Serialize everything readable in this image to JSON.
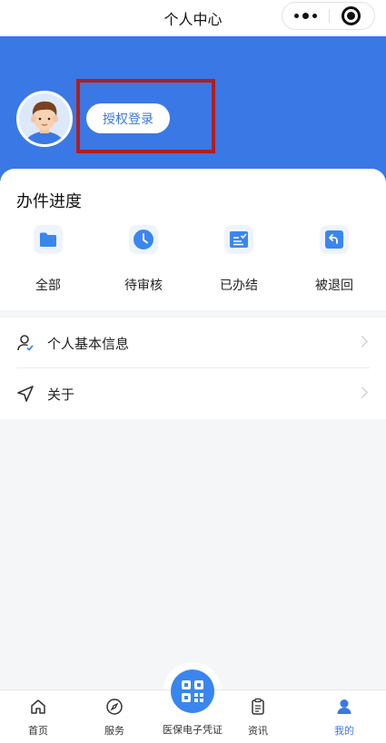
{
  "nav": {
    "title": "个人中心",
    "more_icon": "more-dots-icon",
    "close_icon": "close-circle-icon"
  },
  "header": {
    "avatar_icon": "user-avatar",
    "login_label": "授权登录",
    "accent": "#3a78e6",
    "highlight_color": "#b11e1e"
  },
  "progress": {
    "title": "办件进度",
    "items": [
      {
        "label": "全部",
        "icon": "folder-icon"
      },
      {
        "label": "待审核",
        "icon": "clock-icon"
      },
      {
        "label": "已办结",
        "icon": "check-list-icon"
      },
      {
        "label": "被退回",
        "icon": "return-icon"
      }
    ]
  },
  "menu": {
    "items": [
      {
        "label": "个人基本信息",
        "icon": "user-check-icon"
      },
      {
        "label": "关于",
        "icon": "navigation-icon"
      }
    ]
  },
  "tabbar": {
    "items": [
      {
        "label": "首页",
        "icon": "home-icon",
        "active": false
      },
      {
        "label": "服务",
        "icon": "compass-icon",
        "active": false
      },
      {
        "label": "医保电子凭证",
        "icon": "qr-code-icon",
        "active": false
      },
      {
        "label": "资讯",
        "icon": "news-icon",
        "active": false
      },
      {
        "label": "我的",
        "icon": "person-icon",
        "active": true
      }
    ]
  }
}
